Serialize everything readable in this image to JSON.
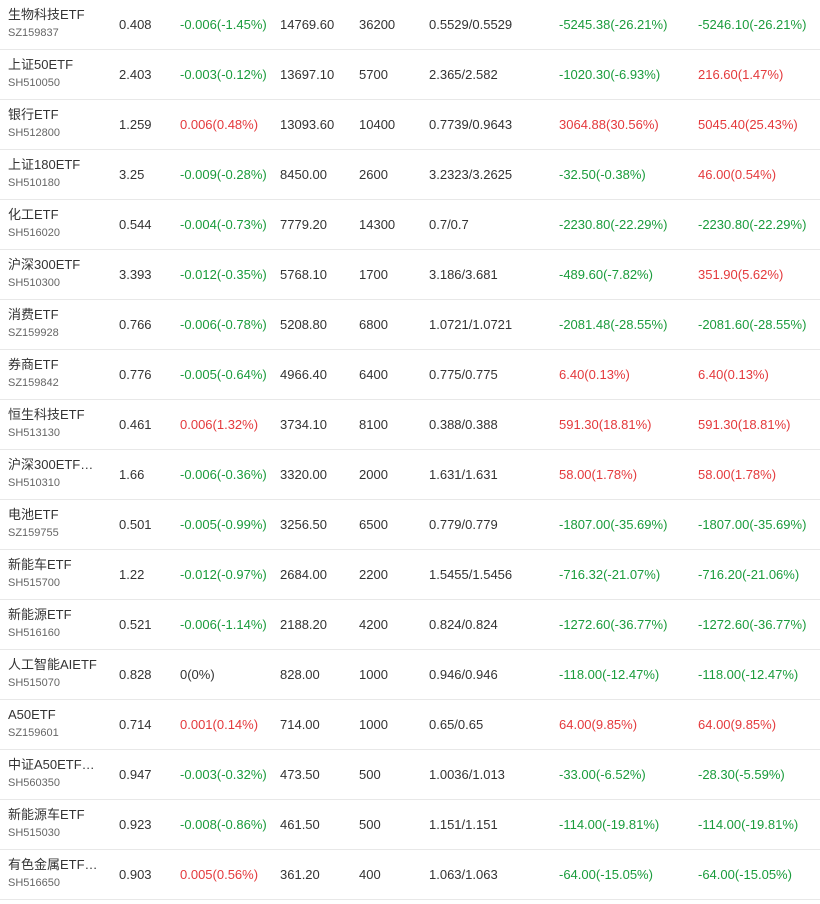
{
  "colors": {
    "up": "#e4393c",
    "down": "#1a9c3c",
    "flat": "#333333"
  },
  "rows": [
    {
      "name": "生物科技ETF",
      "code": "SZ159837",
      "price": "0.408",
      "change": "-0.006(-1.45%)",
      "change_dir": "down",
      "value": "14769.60",
      "shares": "36200",
      "cost": "0.5529/0.5529",
      "pl1": "-5245.38(-26.21%)",
      "pl1_dir": "down",
      "pl2": "-5246.10(-26.21%)",
      "pl2_dir": "down"
    },
    {
      "name": "上证50ETF",
      "code": "SH510050",
      "price": "2.403",
      "change": "-0.003(-0.12%)",
      "change_dir": "down",
      "value": "13697.10",
      "shares": "5700",
      "cost": "2.365/2.582",
      "pl1": "-1020.30(-6.93%)",
      "pl1_dir": "down",
      "pl2": "216.60(1.47%)",
      "pl2_dir": "up"
    },
    {
      "name": "银行ETF",
      "code": "SH512800",
      "price": "1.259",
      "change": "0.006(0.48%)",
      "change_dir": "up",
      "value": "13093.60",
      "shares": "10400",
      "cost": "0.7739/0.9643",
      "pl1": "3064.88(30.56%)",
      "pl1_dir": "up",
      "pl2": "5045.40(25.43%)",
      "pl2_dir": "up"
    },
    {
      "name": "上证180ETF",
      "code": "SH510180",
      "price": "3.25",
      "change": "-0.009(-0.28%)",
      "change_dir": "down",
      "value": "8450.00",
      "shares": "2600",
      "cost": "3.2323/3.2625",
      "pl1": "-32.50(-0.38%)",
      "pl1_dir": "down",
      "pl2": "46.00(0.54%)",
      "pl2_dir": "up"
    },
    {
      "name": "化工ETF",
      "code": "SH516020",
      "price": "0.544",
      "change": "-0.004(-0.73%)",
      "change_dir": "down",
      "value": "7779.20",
      "shares": "14300",
      "cost": "0.7/0.7",
      "pl1": "-2230.80(-22.29%)",
      "pl1_dir": "down",
      "pl2": "-2230.80(-22.29%)",
      "pl2_dir": "down"
    },
    {
      "name": "沪深300ETF",
      "code": "SH510300",
      "price": "3.393",
      "change": "-0.012(-0.35%)",
      "change_dir": "down",
      "value": "5768.10",
      "shares": "1700",
      "cost": "3.186/3.681",
      "pl1": "-489.60(-7.82%)",
      "pl1_dir": "down",
      "pl2": "351.90(5.62%)",
      "pl2_dir": "up"
    },
    {
      "name": "消费ETF",
      "code": "SZ159928",
      "price": "0.766",
      "change": "-0.006(-0.78%)",
      "change_dir": "down",
      "value": "5208.80",
      "shares": "6800",
      "cost": "1.0721/1.0721",
      "pl1": "-2081.48(-28.55%)",
      "pl1_dir": "down",
      "pl2": "-2081.60(-28.55%)",
      "pl2_dir": "down"
    },
    {
      "name": "券商ETF",
      "code": "SZ159842",
      "price": "0.776",
      "change": "-0.005(-0.64%)",
      "change_dir": "down",
      "value": "4966.40",
      "shares": "6400",
      "cost": "0.775/0.775",
      "pl1": "6.40(0.13%)",
      "pl1_dir": "up",
      "pl2": "6.40(0.13%)",
      "pl2_dir": "up"
    },
    {
      "name": "恒生科技ETF",
      "code": "SH513130",
      "price": "0.461",
      "change": "0.006(1.32%)",
      "change_dir": "up",
      "value": "3734.10",
      "shares": "8100",
      "cost": "0.388/0.388",
      "pl1": "591.30(18.81%)",
      "pl1_dir": "up",
      "pl2": "591.30(18.81%)",
      "pl2_dir": "up"
    },
    {
      "name": "沪深300ETF…",
      "code": "SH510310",
      "price": "1.66",
      "change": "-0.006(-0.36%)",
      "change_dir": "down",
      "value": "3320.00",
      "shares": "2000",
      "cost": "1.631/1.631",
      "pl1": "58.00(1.78%)",
      "pl1_dir": "up",
      "pl2": "58.00(1.78%)",
      "pl2_dir": "up"
    },
    {
      "name": "电池ETF",
      "code": "SZ159755",
      "price": "0.501",
      "change": "-0.005(-0.99%)",
      "change_dir": "down",
      "value": "3256.50",
      "shares": "6500",
      "cost": "0.779/0.779",
      "pl1": "-1807.00(-35.69%)",
      "pl1_dir": "down",
      "pl2": "-1807.00(-35.69%)",
      "pl2_dir": "down"
    },
    {
      "name": "新能车ETF",
      "code": "SH515700",
      "price": "1.22",
      "change": "-0.012(-0.97%)",
      "change_dir": "down",
      "value": "2684.00",
      "shares": "2200",
      "cost": "1.5455/1.5456",
      "pl1": "-716.32(-21.07%)",
      "pl1_dir": "down",
      "pl2": "-716.20(-21.06%)",
      "pl2_dir": "down"
    },
    {
      "name": "新能源ETF",
      "code": "SH516160",
      "price": "0.521",
      "change": "-0.006(-1.14%)",
      "change_dir": "down",
      "value": "2188.20",
      "shares": "4200",
      "cost": "0.824/0.824",
      "pl1": "-1272.60(-36.77%)",
      "pl1_dir": "down",
      "pl2": "-1272.60(-36.77%)",
      "pl2_dir": "down"
    },
    {
      "name": "人工智能AIETF",
      "code": "SH515070",
      "price": "0.828",
      "change": "0(0%)",
      "change_dir": "flat",
      "value": "828.00",
      "shares": "1000",
      "cost": "0.946/0.946",
      "pl1": "-118.00(-12.47%)",
      "pl1_dir": "down",
      "pl2": "-118.00(-12.47%)",
      "pl2_dir": "down"
    },
    {
      "name": "A50ETF",
      "code": "SZ159601",
      "price": "0.714",
      "change": "0.001(0.14%)",
      "change_dir": "up",
      "value": "714.00",
      "shares": "1000",
      "cost": "0.65/0.65",
      "pl1": "64.00(9.85%)",
      "pl1_dir": "up",
      "pl2": "64.00(9.85%)",
      "pl2_dir": "up"
    },
    {
      "name": "中证A50ETF…",
      "code": "SH560350",
      "price": "0.947",
      "change": "-0.003(-0.32%)",
      "change_dir": "down",
      "value": "473.50",
      "shares": "500",
      "cost": "1.0036/1.013",
      "pl1": "-33.00(-6.52%)",
      "pl1_dir": "down",
      "pl2": "-28.30(-5.59%)",
      "pl2_dir": "down"
    },
    {
      "name": "新能源车ETF",
      "code": "SH515030",
      "price": "0.923",
      "change": "-0.008(-0.86%)",
      "change_dir": "down",
      "value": "461.50",
      "shares": "500",
      "cost": "1.151/1.151",
      "pl1": "-114.00(-19.81%)",
      "pl1_dir": "down",
      "pl2": "-114.00(-19.81%)",
      "pl2_dir": "down"
    },
    {
      "name": "有色金属ETF…",
      "code": "SH516650",
      "price": "0.903",
      "change": "0.005(0.56%)",
      "change_dir": "up",
      "value": "361.20",
      "shares": "400",
      "cost": "1.063/1.063",
      "pl1": "-64.00(-15.05%)",
      "pl1_dir": "down",
      "pl2": "-64.00(-15.05%)",
      "pl2_dir": "down"
    }
  ]
}
